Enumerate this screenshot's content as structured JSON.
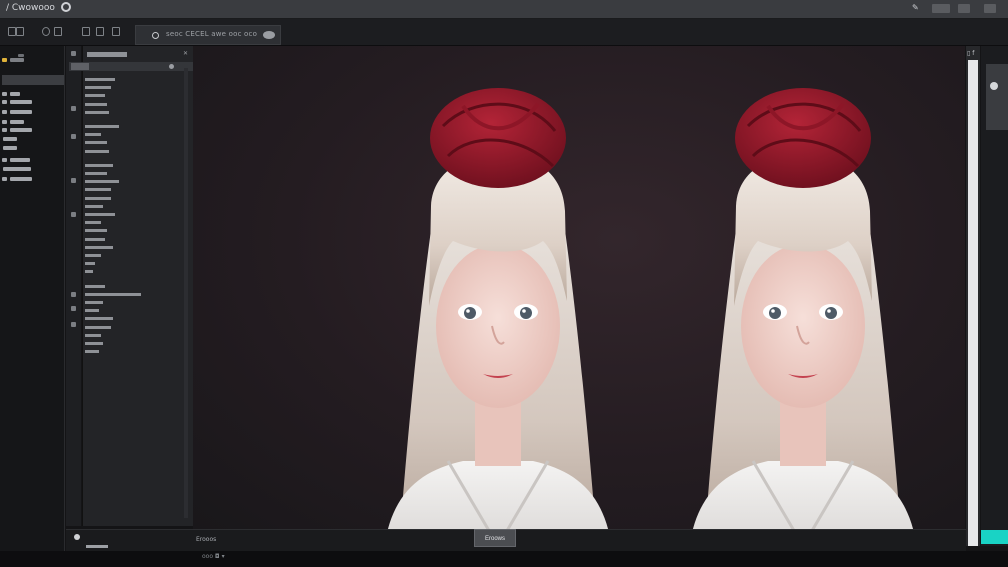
{
  "window": {
    "title": "/ Cwowooo"
  },
  "toolbar": {
    "active_tab_label": "seoc CECEL awe ooc oco"
  },
  "bottom": {
    "render_button": "Eroows",
    "status_text": "Erooos"
  },
  "footer": {
    "zoom_text": "ooo  ◘  ▾"
  },
  "colors": {
    "accent": "#19d3c5",
    "canvas_bg": "#2a2125",
    "hat": "#9a1b2b",
    "hair": "#e8ddd4"
  },
  "icons": [
    "gear-icon",
    "pen-icon",
    "eye-icon",
    "folder-icon",
    "close-icon"
  ]
}
